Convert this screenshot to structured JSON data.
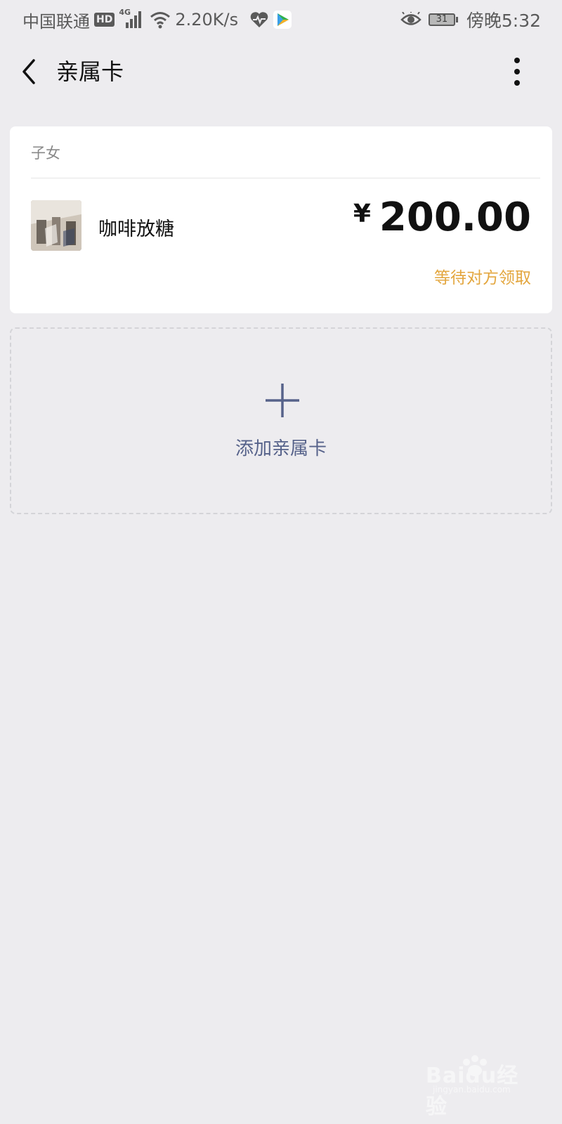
{
  "status_bar": {
    "carrier": "中国联通",
    "hd": "HD",
    "network": "4G",
    "speed": "2.20K/s",
    "battery": "31",
    "time": "傍晚5:32",
    "icons": [
      "hd-icon",
      "signal-icon",
      "wifi-icon",
      "health-heart-icon",
      "video-app-icon",
      "eye-comfort-icon",
      "battery-icon"
    ]
  },
  "header": {
    "title": "亲属卡",
    "back_icon": "chevron-left-icon",
    "more_icon": "more-vertical-icon"
  },
  "card": {
    "category": "子女",
    "holder_name": "咖啡放糖",
    "currency": "¥",
    "amount": "200.00",
    "status": "等待对方领取",
    "status_color": "#E3A63E"
  },
  "add_card": {
    "label": "添加亲属卡",
    "icon": "plus-icon",
    "accent_color": "#56628A"
  },
  "watermark": {
    "text": "Baidu经验",
    "sub": "jingyan.baidu.com"
  }
}
